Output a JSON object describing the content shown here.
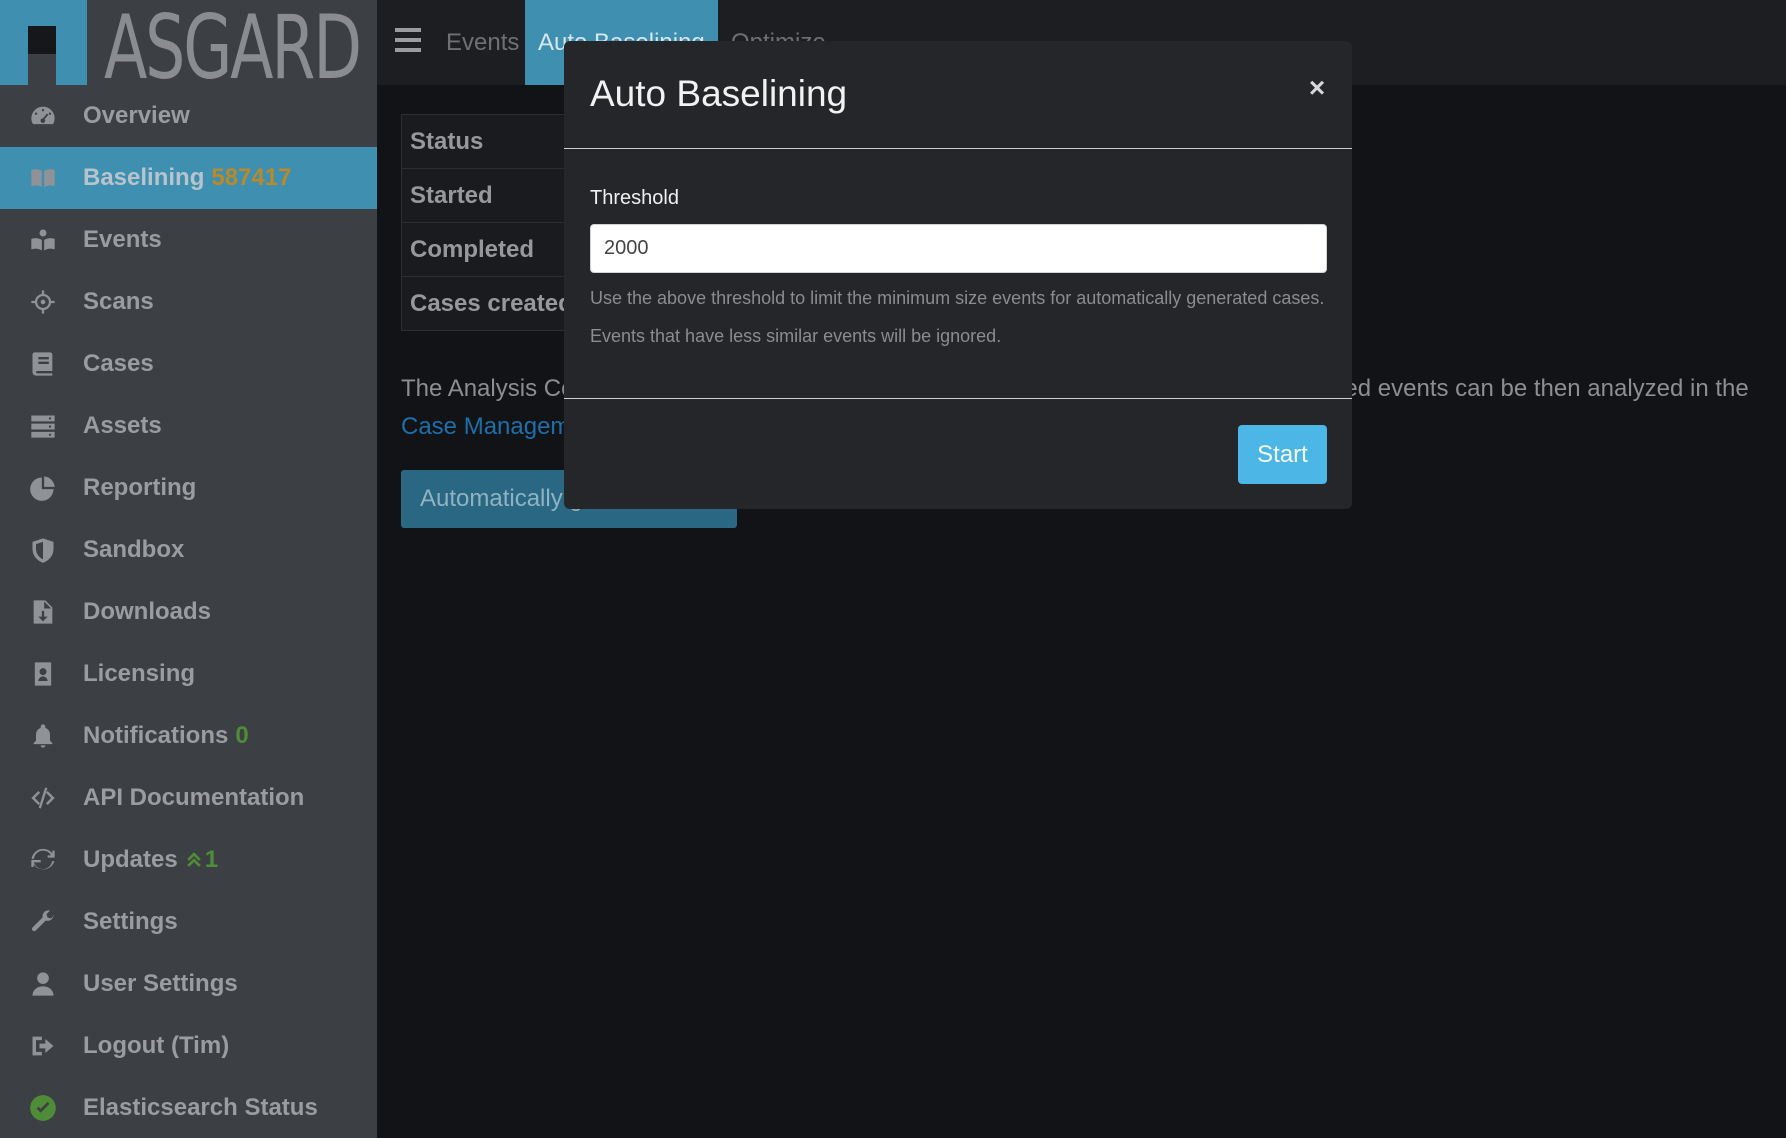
{
  "app": {
    "logo_text": "ASGARD"
  },
  "topbar": {
    "tabs": [
      {
        "label": "Events",
        "active": false
      },
      {
        "label": "Auto Baselining",
        "active": true
      },
      {
        "label": "Optimize",
        "active": false
      }
    ]
  },
  "sidebar": {
    "items": [
      {
        "label": "Overview",
        "icon": "dashboard-icon"
      },
      {
        "label": "Baselining",
        "icon": "book-icon",
        "badge": "587417",
        "active": true
      },
      {
        "label": "Events",
        "icon": "events-icon"
      },
      {
        "label": "Scans",
        "icon": "crosshair-icon"
      },
      {
        "label": "Cases",
        "icon": "case-book-icon"
      },
      {
        "label": "Assets",
        "icon": "server-icon"
      },
      {
        "label": "Reporting",
        "icon": "pie-chart-icon"
      },
      {
        "label": "Sandbox",
        "icon": "shield-icon"
      },
      {
        "label": "Downloads",
        "icon": "file-download-icon"
      },
      {
        "label": "Licensing",
        "icon": "id-badge-icon"
      },
      {
        "label": "Notifications",
        "icon": "bell-icon",
        "badge": "0"
      },
      {
        "label": "API Documentation",
        "icon": "code-icon"
      },
      {
        "label": "Updates",
        "icon": "sync-icon",
        "badge": "1"
      },
      {
        "label": "Settings",
        "icon": "wrench-icon"
      },
      {
        "label": "User Settings",
        "icon": "user-icon"
      },
      {
        "label": "Logout (Tim)",
        "icon": "sign-out-icon"
      },
      {
        "label": "Elasticsearch Status",
        "icon": "check-circle-icon"
      }
    ]
  },
  "main": {
    "status_rows": [
      {
        "key": "Status"
      },
      {
        "key": "Started"
      },
      {
        "key": "Completed"
      },
      {
        "key": "Cases created"
      }
    ],
    "intro_before": "The Analysis Coc",
    "intro_middle": "ed events can be then analyzed in the ",
    "intro_link": "Case Management",
    "intro_after": ".",
    "auto_button_label": "Automatically g"
  },
  "modal": {
    "title": "Auto Baselining",
    "close_label": "×",
    "threshold_label": "Threshold",
    "threshold_value": "2000",
    "help_line1": "Use the above threshold to limit the minimum size events for automatically generated cases.",
    "help_line2": "Events that have less similar events will be ignored.",
    "start_label": "Start"
  },
  "colors": {
    "accent": "#3e8fb0",
    "sidebar_bg": "#3c3f43",
    "badge_orange": "#b98a2a",
    "badge_green": "#4f8c38",
    "start_button": "#4cb7e6"
  }
}
